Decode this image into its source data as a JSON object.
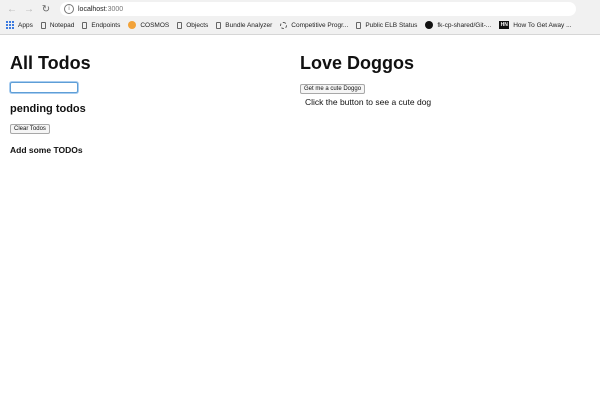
{
  "browser": {
    "url_host": "localhost",
    "url_port": ":3000",
    "nav_icons": {
      "back": "arrow-left-icon",
      "forward": "arrow-right-icon",
      "reload": "reload-icon",
      "info": "info-icon"
    },
    "bookmarks": [
      {
        "label": "Apps",
        "icon": "apps-grid-icon"
      },
      {
        "label": "Notepad",
        "icon": "page-icon"
      },
      {
        "label": "Endpoints",
        "icon": "page-icon"
      },
      {
        "label": "COSMOS",
        "icon": "cosmos-icon"
      },
      {
        "label": "Objects",
        "icon": "page-icon"
      },
      {
        "label": "Bundle Analyzer",
        "icon": "page-icon"
      },
      {
        "label": "Competitive Progr...",
        "icon": "loading-icon"
      },
      {
        "label": "Public ELB Status",
        "icon": "page-icon"
      },
      {
        "label": "fk-cp-shared/Git-...",
        "icon": "github-icon"
      },
      {
        "label": "How To Get Away ...",
        "icon": "hn-icon"
      }
    ],
    "hn_icon_text": "HN"
  },
  "todos": {
    "title": "All Todos",
    "input_value": "",
    "pending_heading": "pending todos",
    "clear_button": "Clear Todos",
    "add_heading": "Add some TODOs"
  },
  "doggos": {
    "title": "Love Doggos",
    "button": "Get me a cute Doggo",
    "hint": "Click the button to see a cute dog"
  },
  "colors": {
    "input_focus": "#5e9ed6",
    "apps_icon": "#3c7be0",
    "cosmos_icon": "#f2a33a"
  }
}
